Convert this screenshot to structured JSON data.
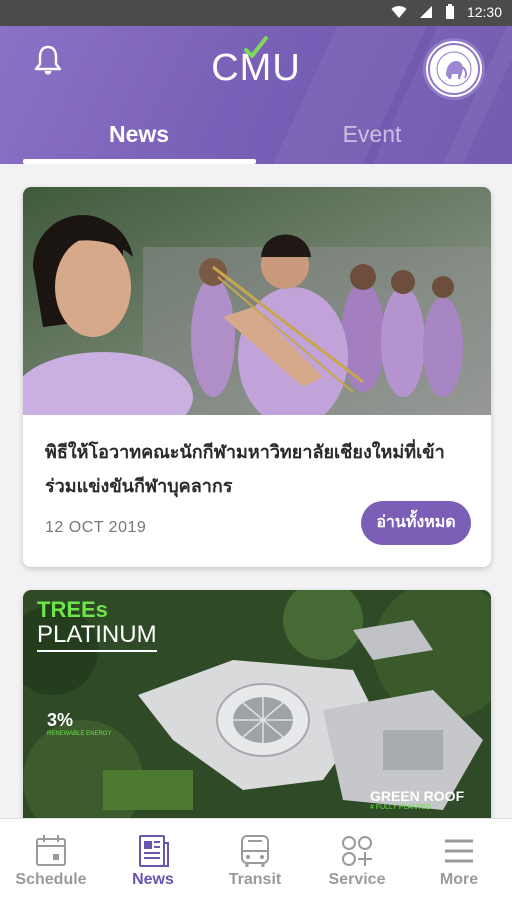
{
  "status_bar": {
    "time": "12:30"
  },
  "header": {
    "app_logo_text": "CMU",
    "tabs": [
      {
        "label": "News",
        "active": true
      },
      {
        "label": "Event",
        "active": false
      }
    ]
  },
  "feed": {
    "cards": [
      {
        "title": "พิธีให้โอวาทคณะนักกีฬามหาวิทยาลัยเชียงใหม่ที่เข้าร่วมแข่งขันกีฬาบุคลากร",
        "date": "12 OCT 2019",
        "read_more_label": "อ่านทั้งหมด"
      },
      {
        "image_texts": {
          "trees": "TREEs",
          "platinum": "PLATINUM",
          "percent": "3%",
          "percent_caption": "RENEWABLE ENERGY",
          "green_roof": "GREEN ROOF",
          "green_roof_caption": "# FULLY PLANTED"
        }
      }
    ]
  },
  "bottom_nav": {
    "items": [
      {
        "label": "Schedule",
        "icon": "calendar-icon",
        "active": false
      },
      {
        "label": "News",
        "icon": "newspaper-icon",
        "active": true
      },
      {
        "label": "Transit",
        "icon": "bus-icon",
        "active": false
      },
      {
        "label": "Service",
        "icon": "service-grid-icon",
        "active": false
      },
      {
        "label": "More",
        "icon": "menu-icon",
        "active": false
      }
    ]
  },
  "colors": {
    "brand": "#7b5fb6",
    "active_nav": "#6a54b0",
    "header_bg": "#7a61b8"
  }
}
